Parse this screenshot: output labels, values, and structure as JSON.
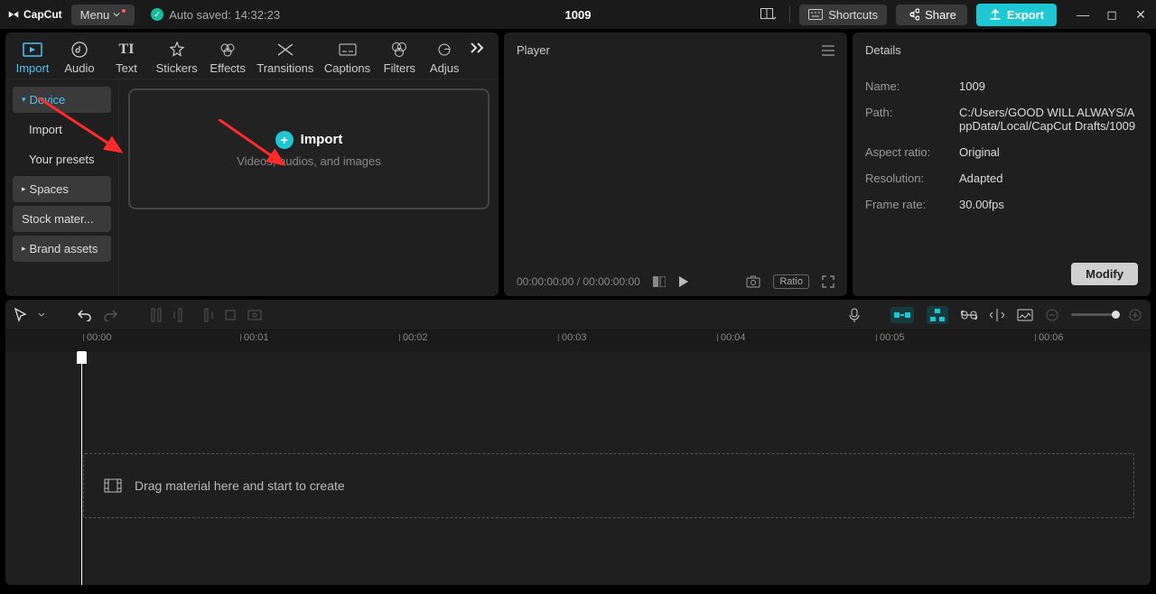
{
  "titlebar": {
    "app_name": "CapCut",
    "menu_label": "Menu",
    "autosave_label": "Auto saved: 14:32:23",
    "project_title": "1009",
    "shortcuts_label": "Shortcuts",
    "share_label": "Share",
    "export_label": "Export"
  },
  "media_tabs": [
    {
      "label": "Import"
    },
    {
      "label": "Audio"
    },
    {
      "label": "Text"
    },
    {
      "label": "Stickers"
    },
    {
      "label": "Effects"
    },
    {
      "label": "Transitions"
    },
    {
      "label": "Captions"
    },
    {
      "label": "Filters"
    },
    {
      "label": "Adjus"
    }
  ],
  "media_sidebar": {
    "device": "Device",
    "import": "Import",
    "presets": "Your presets",
    "spaces": "Spaces",
    "stock": "Stock mater...",
    "brand": "Brand assets"
  },
  "import_zone": {
    "title": "Import",
    "subtitle": "Videos, audios, and images"
  },
  "player": {
    "title": "Player",
    "time_current": "00:00:00:00",
    "time_total": "00:00:00:00",
    "ratio_label": "Ratio"
  },
  "details": {
    "title": "Details",
    "rows": [
      {
        "label": "Name:",
        "value": "1009"
      },
      {
        "label": "Path:",
        "value": "C:/Users/GOOD WILL ALWAYS/AppData/Local/CapCut Drafts/1009"
      },
      {
        "label": "Aspect ratio:",
        "value": "Original"
      },
      {
        "label": "Resolution:",
        "value": "Adapted"
      },
      {
        "label": "Frame rate:",
        "value": "30.00fps"
      }
    ],
    "modify_label": "Modify"
  },
  "timeline": {
    "ruler": [
      "00:00",
      "00:01",
      "00:02",
      "00:03",
      "00:04",
      "00:05",
      "00:06"
    ],
    "drag_hint": "Drag material here and start to create"
  }
}
